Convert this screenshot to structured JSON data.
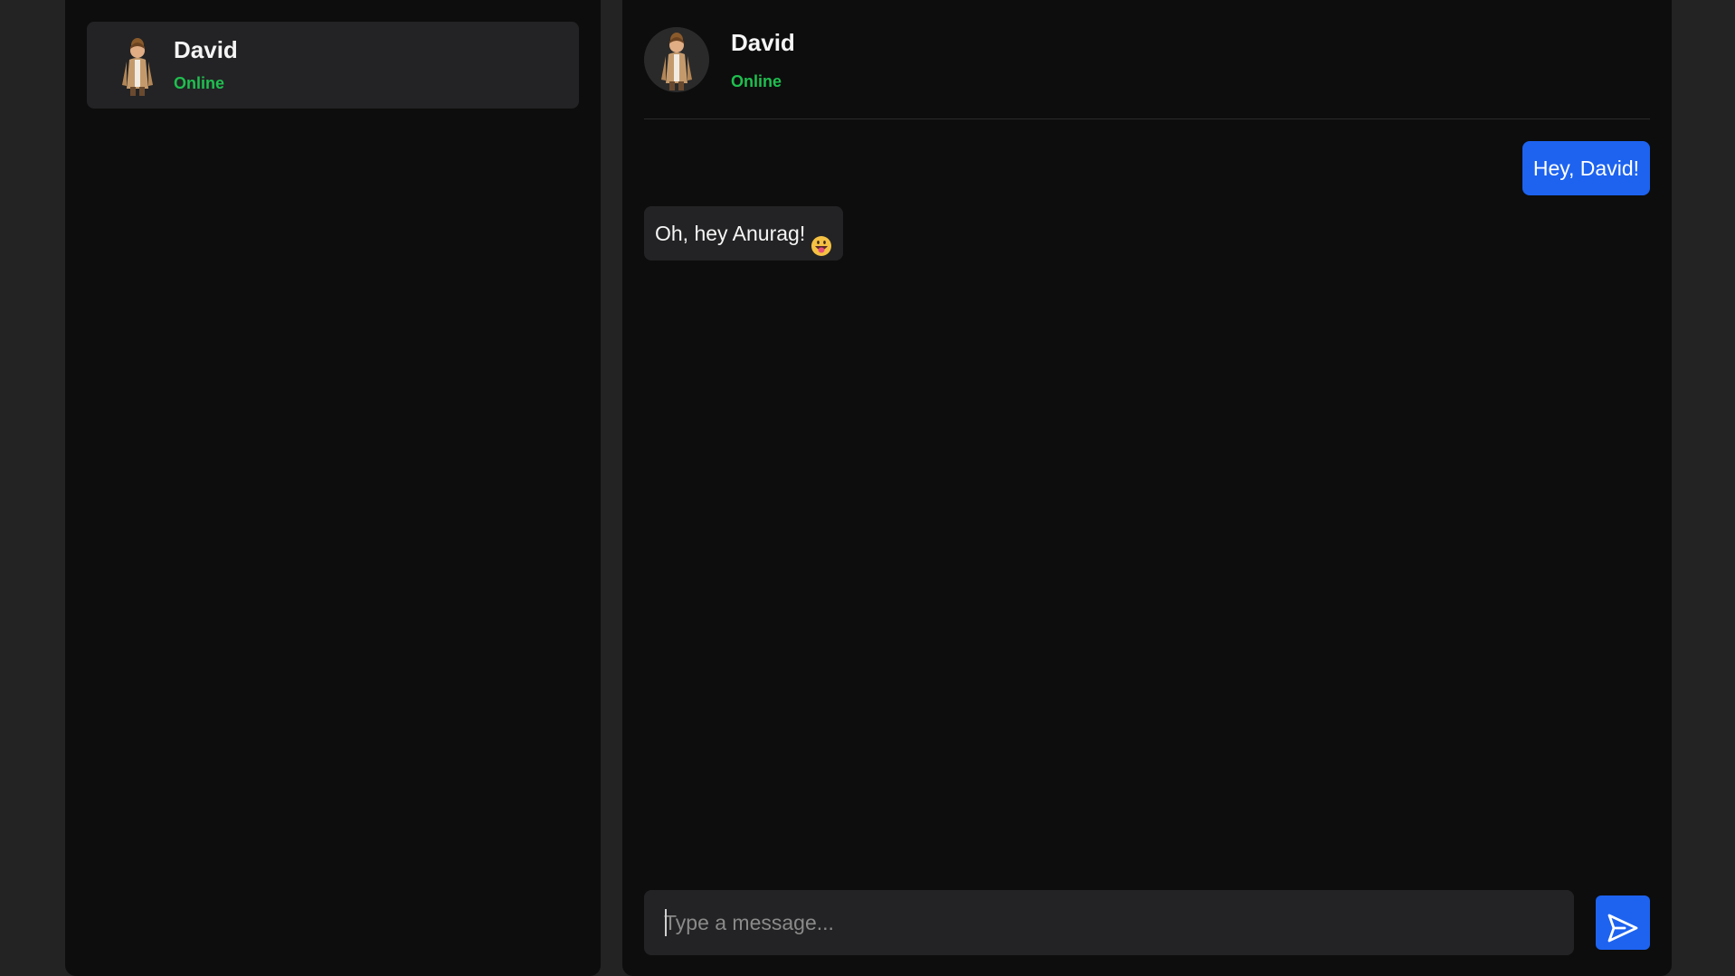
{
  "sidebar": {
    "contacts": [
      {
        "name": "David",
        "status": "Online",
        "avatar_icon": "character-avatar"
      }
    ]
  },
  "chat": {
    "header": {
      "name": "David",
      "status": "Online",
      "avatar_icon": "character-avatar"
    },
    "messages": [
      {
        "direction": "outgoing",
        "text": "Hey, David!"
      },
      {
        "direction": "incoming",
        "text": "Oh, hey Anurag!",
        "emoji": "grinning-face-tongue"
      }
    ],
    "composer": {
      "placeholder": "Type a message...",
      "value": "",
      "send_icon": "send-icon"
    }
  },
  "colors": {
    "background": "#232323",
    "panel": "#0d0d0d",
    "card": "#232325",
    "accent": "#1d63f0",
    "online": "#1fbf4f"
  }
}
